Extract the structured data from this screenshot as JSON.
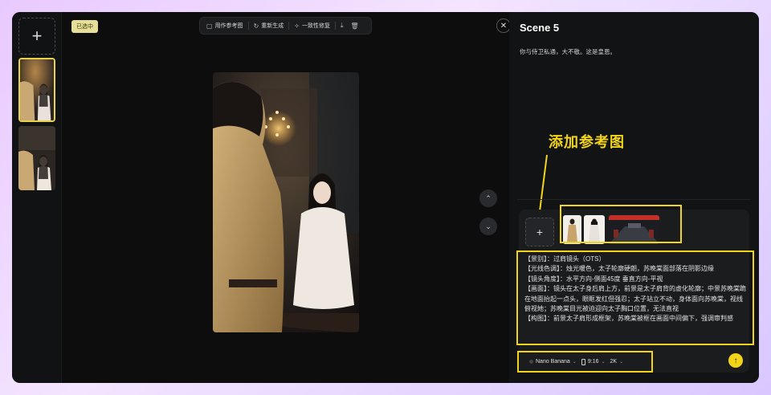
{
  "sidebar": {
    "add_symbol": "+"
  },
  "viewer": {
    "selected_badge": "已选中",
    "toolbar": {
      "use_as_reference": "用作参考图",
      "regenerate": "重新生成",
      "consistency_fix": "一致性修复"
    },
    "close_symbol": "✕"
  },
  "panel": {
    "scene_title": "Scene 5",
    "scene_description": "你与侍卫私通，大不敬。这是皇恩。",
    "annotation_label": "添加参考图",
    "add_reference_symbol": "+",
    "prompt_text": "【景别】：过肩镜头（OTS）\n【光线色调】：烛光暖色，太子轮廓硬朗，苏晚棠面部落在阴影边缘\n【镜头角度】：水平方向-侧面45度 垂直方向-平视\n【画面】：镜头在太子身后肩上方，前景是太子肩背的虚化轮廓；中景苏晚棠跪在地面抬起一点头，眼眶发红但强忍；太子站立不动，身体面向苏晚棠，视线俯视她；苏晚棠目光被迫迎向太子胸口位置，无法直视\n【构图】：前景太子肩形成框架，苏晚棠被框在画面中间偏下，强调审判感",
    "model": "Nano Banana",
    "aspect_ratio": "9:16",
    "resolution": "2K"
  },
  "colors": {
    "accent_yellow": "#f2d518",
    "badge_bg": "#e6df9a",
    "background": "#0e0e0f"
  },
  "icons": [
    "plus-icon",
    "image-icon",
    "refresh-icon",
    "wand-icon",
    "download-icon",
    "trash-icon",
    "close-icon",
    "chevron-up-icon",
    "chevron-down-icon",
    "arrow-up-icon"
  ]
}
